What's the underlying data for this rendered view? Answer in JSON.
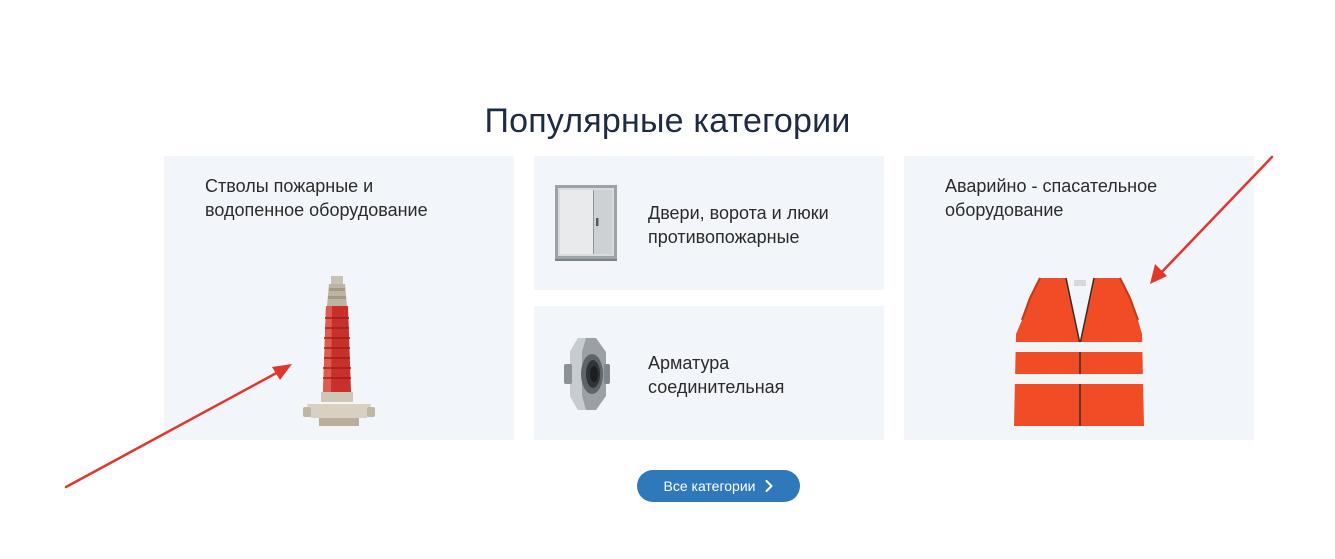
{
  "section": {
    "title": "Популярные категории"
  },
  "categories": [
    {
      "label": "Стволы пожарные и\nводопенное оборудование",
      "icon": "fire-nozzle-icon"
    },
    {
      "label": "Двери, ворота и люки\nпротивопожарные",
      "icon": "fire-door-icon"
    },
    {
      "label": "Арматура\nсоединительная",
      "icon": "hose-coupling-icon"
    },
    {
      "label": "Аварийно - спасательное\nоборудование",
      "icon": "safety-vest-icon"
    }
  ],
  "all_button": {
    "label": "Все категории",
    "icon": "chevron-right-icon"
  },
  "colors": {
    "title": "#1f2a44",
    "card_bg": "#f2f5f9",
    "button_bg": "#2f79ba",
    "annotation_arrow": "#e0362c"
  }
}
